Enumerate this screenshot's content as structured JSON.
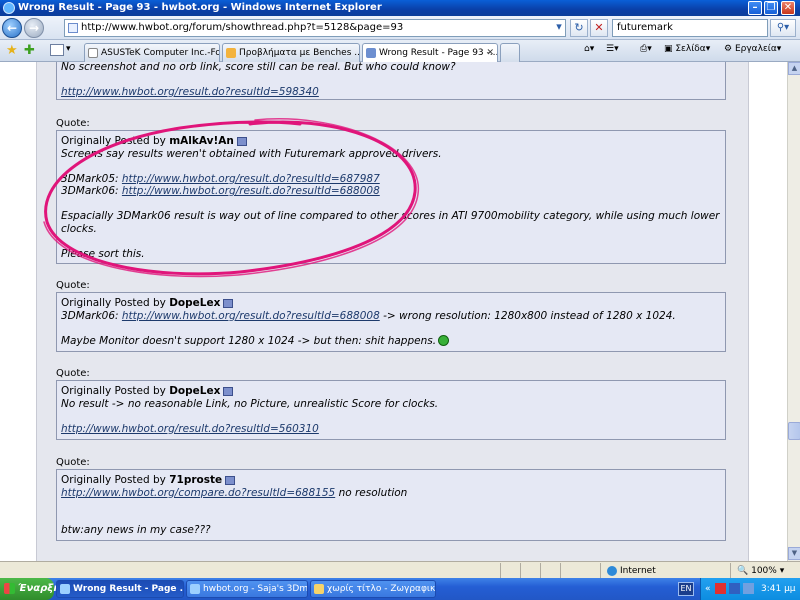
{
  "window": {
    "title": "Wrong Result - Page 93 - hwbot.org - Windows Internet Explorer"
  },
  "address_bar": {
    "url": "http://www.hwbot.org/forum/showthread.php?t=5128&page=93",
    "search_value": "futuremark"
  },
  "tabs": [
    {
      "label": "ASUSTeK Computer Inc.-For...",
      "active": false
    },
    {
      "label": "Προβλήματα με Benches ...P...",
      "active": false
    },
    {
      "label": "Wrong Result - Page 93 -...",
      "active": true
    }
  ],
  "command_bar": {
    "page_label": "Σελίδα",
    "tools_label": "Εργαλεία"
  },
  "posts": {
    "top_partial": {
      "line1": "No screenshot and no orb link, score still can be real. But who could know?",
      "link": "http://www.hwbot.org/result.do?resultId=598340"
    },
    "quote_label": "Quote:",
    "originally_posted_by": "Originally Posted by",
    "q1": {
      "author": "mAlkAv!An",
      "line1": "Screens say results weren't obtained with Futuremark approved drivers.",
      "l1_prefix": "3DMark05:",
      "l1_link": "http://www.hwbot.org/result.do?resultId=687987",
      "l2_prefix": "3DMark06:",
      "l2_link": "http://www.hwbot.org/result.do?resultId=688008",
      "line3a": "Espacially 3DMark06 result is way out of line compared to other scores in ATI 9700mobility category, while using much lower",
      "line3b": "clocks.",
      "line4": "Please sort this."
    },
    "q2": {
      "author": "DopeLex",
      "prefix": "3DMark06:",
      "link": "http://www.hwbot.org/result.do?resultId=688008",
      "suffix": "-> wrong resolution: 1280x800 instead of 1280 x 1024.",
      "line2": "Maybe Monitor doesn't support 1280 x 1024 -> but then: shit happens."
    },
    "q3": {
      "author": "DopeLex",
      "line1": "No result -> no reasonable Link, no Picture, unrealistic Score for clocks.",
      "link": "http://www.hwbot.org/result.do?resultId=560310"
    },
    "q4": {
      "author": "71proste",
      "link": "http://www.hwbot.org/compare.do?resultId=688155",
      "suffix": "no resolution",
      "line2": "btw:any news in my case???"
    }
  },
  "status_bar": {
    "zone": "Internet",
    "zoom": "100%"
  },
  "taskbar": {
    "start_label": "Έναρξη",
    "items": [
      {
        "label": "Wrong Result - Page ...",
        "active": true
      },
      {
        "label": "hwbot.org - Saja's 3Dma...",
        "active": false
      },
      {
        "label": "χωρίς τίτλο - Ζωγραφική",
        "active": false
      }
    ],
    "language": "EN",
    "clock": "3:41 μμ"
  },
  "colors": {
    "annotation_circle": "#e0157a",
    "link": "#1d3a6c",
    "post_bg": "#e5e8f4"
  }
}
